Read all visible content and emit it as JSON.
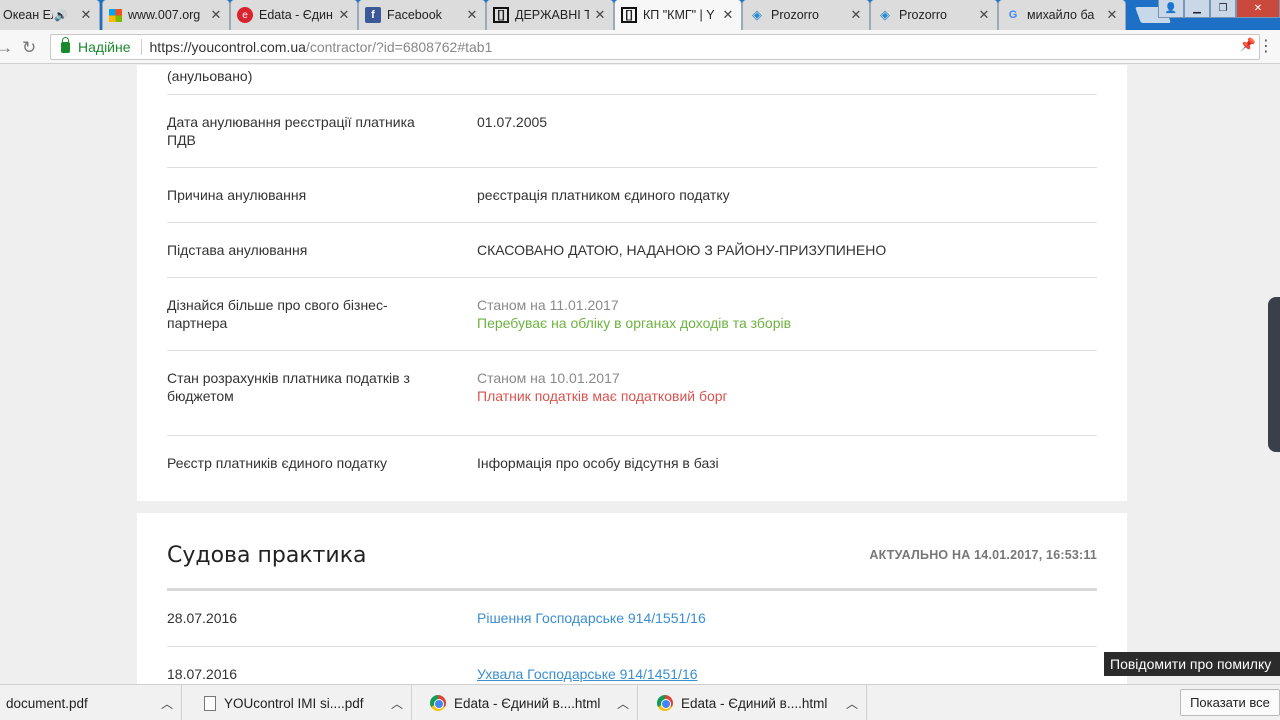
{
  "tabs": [
    {
      "title": "Океан Ельзи",
      "favicon": "speaker-icon"
    },
    {
      "title": "www.007.org",
      "favicon": "windows-icon"
    },
    {
      "title": "Edata - Єдиний",
      "favicon": "edata-icon"
    },
    {
      "title": "Facebook",
      "favicon": "facebook-icon"
    },
    {
      "title": "ДЕРЖАВНІ Т",
      "favicon": "bracket-icon"
    },
    {
      "title": "КП \"КМГ\" | Y",
      "favicon": "bracket-icon"
    },
    {
      "title": "Prozorro",
      "favicon": "prozorro-icon"
    },
    {
      "title": "Prozorro",
      "favicon": "prozorro-icon"
    },
    {
      "title": "михайло ба",
      "favicon": "google-icon"
    }
  ],
  "address": {
    "secure_label": "Надійне",
    "url_host": "https://youcontrol.com.ua",
    "url_path": "/contractor/?id=6808762#tab1"
  },
  "info_rows": {
    "r0": {
      "label": "(анульовано)"
    },
    "r1": {
      "label": "Дата анулювання реєстрації платника ПДВ",
      "value": "01.07.2005"
    },
    "r2": {
      "label": "Причина анулювання",
      "value": "реєстрація платником єдиного податку"
    },
    "r3": {
      "label": "Підстава анулювання",
      "value": "СКАСОВАНО ДАТОЮ, НАДАНОЮ З РАЙОНУ-ПРИЗУПИНЕНО"
    },
    "r4": {
      "label": "Дізнайся більше про свого бізнес-партнера",
      "value_date": "Станом на 11.01.2017",
      "value_status": "Перебуває на обліку в органах доходів та зборів"
    },
    "r5": {
      "label": "Стан розрахунків платника податків з бюджетом",
      "value_date": "Станом на 10.01.2017",
      "value_status": "Платник податків має податковий борг"
    },
    "r6": {
      "label": "Реєстр платників єдиного податку",
      "value": "Інформація про особу відсутня в базі"
    }
  },
  "court": {
    "title": "Судова практика",
    "updated": "АКТУАЛЬНО НА 14.01.2017, 16:53:11",
    "rows": [
      {
        "date": "28.07.2016",
        "link": "Рішення Господарське 914/1551/16"
      },
      {
        "date": "18.07.2016",
        "link": "Ухвала Господарське 914/1451/16"
      }
    ]
  },
  "report_button": "Повідомити про помилку",
  "downloads": [
    {
      "name": "document.pdf"
    },
    {
      "name": "YOUcontrol IMI si....pdf"
    },
    {
      "name": "Edata - Єдиний в....html"
    },
    {
      "name": "Edata - Єдиний в....html"
    }
  ],
  "show_all": "Показати все",
  "colors": {
    "status_ok": "#6cb33f",
    "status_bad": "#d9534f",
    "link": "#3b8ed0",
    "secure": "#1b8a2e"
  }
}
